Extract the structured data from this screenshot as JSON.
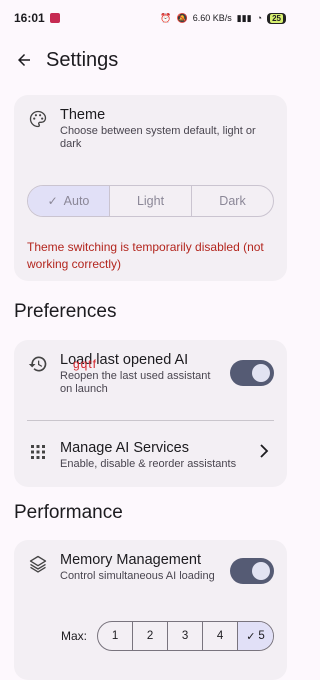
{
  "status": {
    "time": "16:01",
    "net_speed": "6.60 KB/s",
    "battery": "25"
  },
  "appbar": {
    "title": "Settings"
  },
  "theme": {
    "title": "Theme",
    "subtitle": "Choose between system default, light or dark",
    "options": [
      "Auto",
      "Light",
      "Dark"
    ],
    "selected": "Auto",
    "warning": "Theme switching is temporarily disabled (not working correctly)"
  },
  "preferences": {
    "heading": "Preferences",
    "load_last": {
      "title": "Load last opened AI",
      "subtitle": "Reopen the last used assistant on launch",
      "enabled": true
    },
    "manage": {
      "title": "Manage AI Services",
      "subtitle": "Enable, disable & reorder assistants"
    }
  },
  "performance": {
    "heading": "Performance",
    "memory": {
      "title": "Memory Management",
      "subtitle": "Control simultaneous AI loading",
      "enabled": true
    },
    "max_label": "Max:",
    "max_options": [
      "1",
      "2",
      "3",
      "4",
      "5"
    ],
    "max_selected": "5"
  },
  "overlay": "gqtf"
}
